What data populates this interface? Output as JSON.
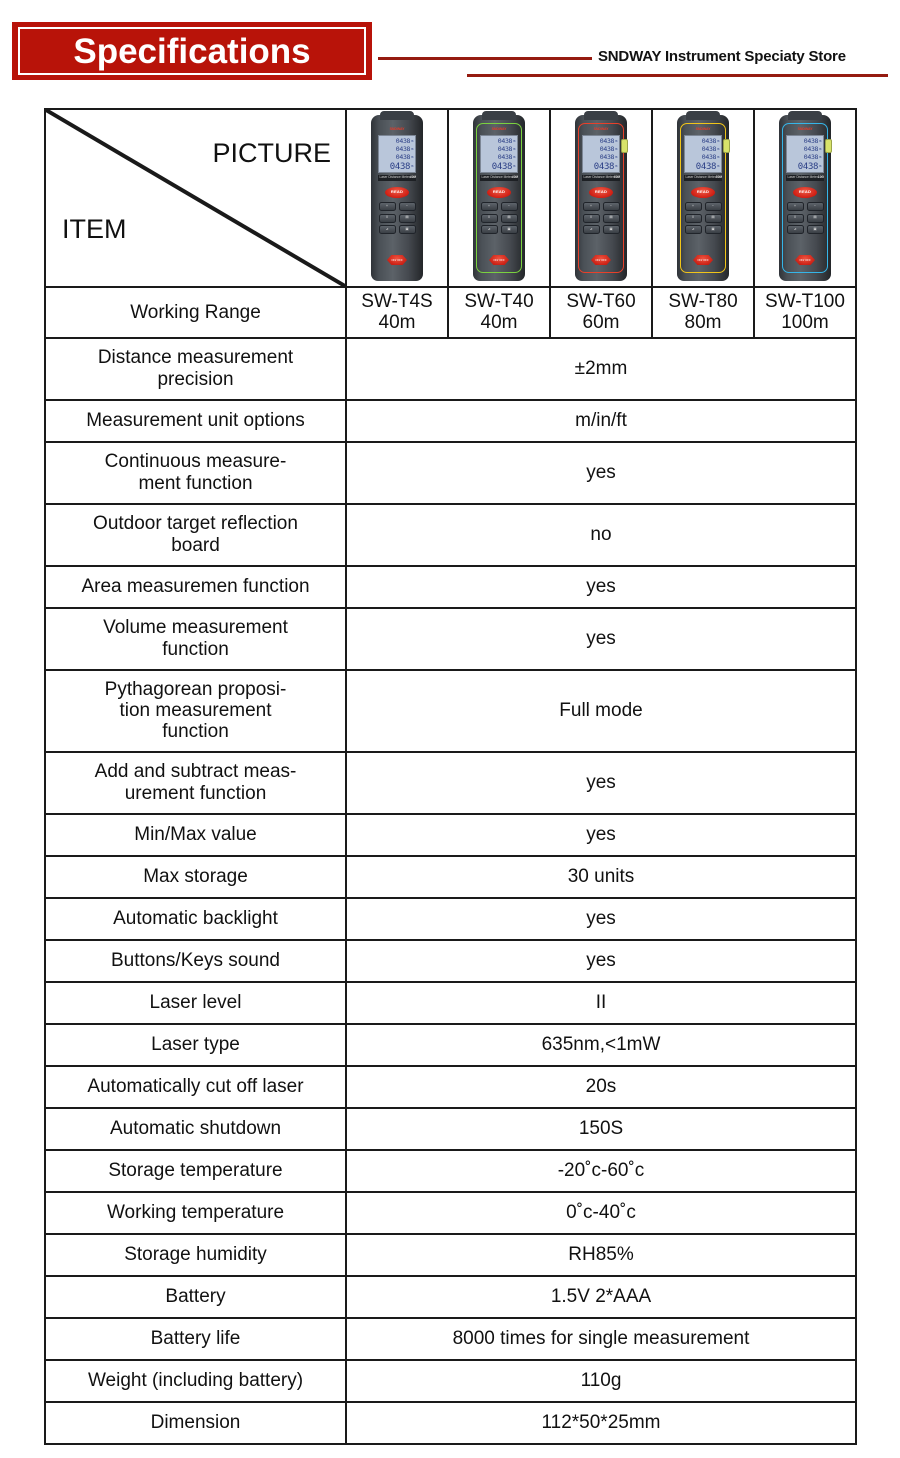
{
  "header": {
    "title": "Specifications",
    "store_name": "SNDWAY Instrument Speciaty Store"
  },
  "table": {
    "corner": {
      "picture_label": "PICTURE",
      "item_label": "ITEM"
    },
    "working_range_label": "Working Range",
    "products": [
      {
        "model": "SW-T4S",
        "range": "40m",
        "accent": "#3a3f45"
      },
      {
        "model": "SW-T40",
        "range": "40m",
        "accent": "#7ad13f"
      },
      {
        "model": "SW-T60",
        "range": "60m",
        "accent": "#e8402a"
      },
      {
        "model": "SW-T80",
        "range": "80m",
        "accent": "#f0c419"
      },
      {
        "model": "SW-T100",
        "range": "100m",
        "accent": "#35b5e8"
      }
    ],
    "lcd": {
      "rows": [
        "0438",
        "0438",
        "0438"
      ],
      "main": "0438",
      "unit": "m",
      "brand": "SNDWAY",
      "label_left": "Laser Distance Meter"
    },
    "buttons": {
      "read": "READ",
      "grid": [
        "+",
        "−",
        "⌸",
        "▤",
        "⊿",
        "▣"
      ],
      "power": "ON/ OFF"
    },
    "rows": [
      {
        "item": "Distance measurement\nprecision",
        "value": "±2mm",
        "lines": 2
      },
      {
        "item": "Measurement unit options",
        "value": "m/in/ft",
        "lines": 1
      },
      {
        "item": "Continuous measure-\nment function",
        "value": "yes",
        "lines": 2
      },
      {
        "item": "Outdoor target reflection\nboard",
        "value": "no",
        "lines": 2
      },
      {
        "item": "Area measuremen function",
        "value": "yes",
        "lines": 1
      },
      {
        "item": "Volume measurement\nfunction",
        "value": "yes",
        "lines": 2
      },
      {
        "item": "Pythagorean proposi-\ntion measurement\nfunction",
        "value": "Full mode",
        "lines": 3
      },
      {
        "item": "Add and subtract meas-\nurement function",
        "value": "yes",
        "lines": 2
      },
      {
        "item": "Min/Max value",
        "value": "yes",
        "lines": 1
      },
      {
        "item": "Max storage",
        "value": "30 units",
        "lines": 1
      },
      {
        "item": "Automatic backlight",
        "value": "yes",
        "lines": 1
      },
      {
        "item": "Buttons/Keys sound",
        "value": "yes",
        "lines": 1
      },
      {
        "item": "Laser level",
        "value": "II",
        "lines": 1
      },
      {
        "item": "Laser type",
        "value": "635nm,<1mW",
        "lines": 1
      },
      {
        "item": "Automatically cut off laser",
        "value": "20s",
        "lines": 1
      },
      {
        "item": "Automatic shutdown",
        "value": "150S",
        "lines": 1
      },
      {
        "item": "Storage temperature",
        "value": "-20˚c-60˚c",
        "lines": 1
      },
      {
        "item": "Working temperature",
        "value": "0˚c-40˚c",
        "lines": 1
      },
      {
        "item": "Storage humidity",
        "value": "RH85%",
        "lines": 1
      },
      {
        "item": "Battery",
        "value": "1.5V 2*AAA",
        "lines": 1
      },
      {
        "item": "Battery life",
        "value": "8000 times for single measurement",
        "lines": 1
      },
      {
        "item": "Weight (including battery)",
        "value": "110g",
        "lines": 1
      },
      {
        "item": "Dimension",
        "value": "112*50*25mm",
        "lines": 1
      }
    ]
  },
  "colors": {
    "brand_red": "#b81309",
    "rule_red": "#951b10",
    "border": "#1a1a1a"
  }
}
